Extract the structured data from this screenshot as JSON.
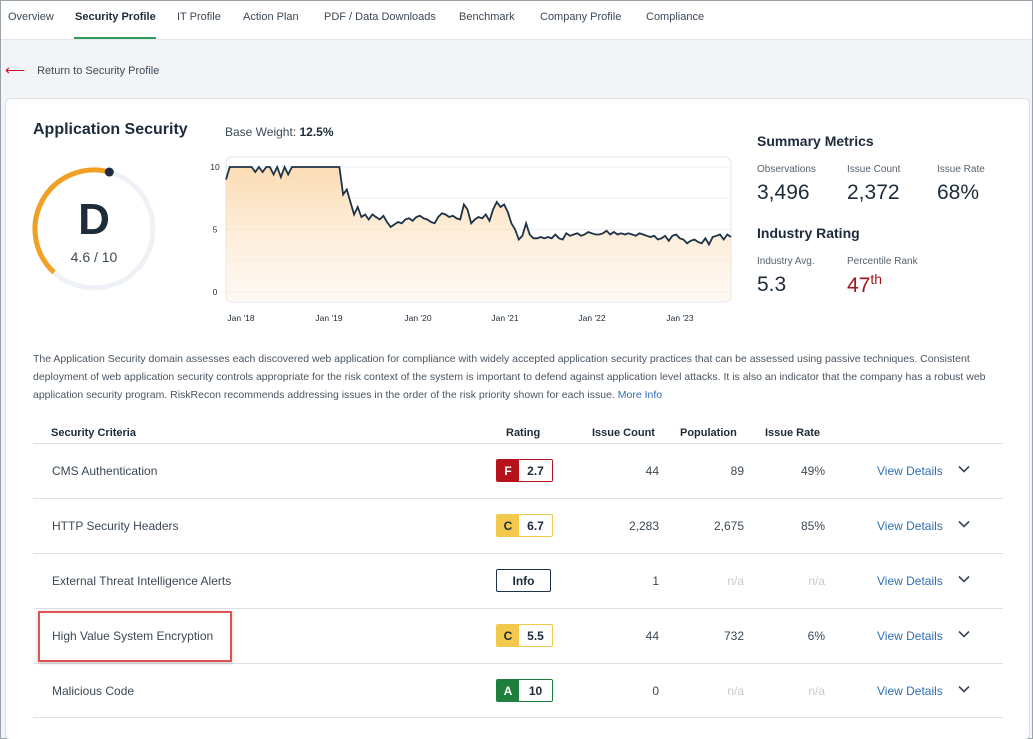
{
  "nav": {
    "tabs": [
      "Overview",
      "Security Profile",
      "IT Profile",
      "Action Plan",
      "PDF / Data Downloads",
      "Benchmark",
      "Company Profile",
      "Compliance"
    ],
    "active_tab": "Security Profile"
  },
  "back_link": "Return to Security Profile",
  "domain": {
    "title": "Application Security",
    "base_weight_label": "Base Weight:",
    "base_weight_value": "12.5%",
    "grade": "D",
    "score": "4.6 / 10",
    "score_value": 4.6
  },
  "chart_data": {
    "type": "area",
    "x_ticks": [
      "Jan '18",
      "Jan '19",
      "Jan '20",
      "Jan '21",
      "Jan '22",
      "Jan '23"
    ],
    "y_ticks": [
      "10",
      "5",
      "0"
    ],
    "ylim": [
      0,
      10
    ],
    "x": [
      0,
      0.5,
      1,
      1.5,
      2,
      2.5,
      3,
      3.5,
      4,
      4.5,
      5,
      5.5,
      6,
      6.5,
      7,
      7.5,
      8,
      8.5,
      9,
      9.5,
      10,
      10.5,
      11,
      11.5,
      12,
      12.5,
      13,
      13.5,
      14,
      14.5,
      15,
      15.5,
      16,
      16.5,
      17,
      17.5,
      18,
      18.5,
      19,
      19.5,
      20,
      20.5,
      21,
      21.5,
      22,
      22.5,
      23,
      23.5,
      24,
      24.5,
      25,
      25.5,
      26,
      26.5,
      27,
      27.5,
      28,
      28.5,
      29,
      29.5,
      30,
      30.5,
      31,
      31.5,
      32,
      32.5,
      33,
      33.5,
      34,
      34.5,
      35,
      35.5,
      36,
      36.5,
      37,
      37.5,
      38,
      38.5,
      39,
      39.5,
      40,
      40.5,
      41,
      41.5,
      42,
      42.5,
      43,
      43.5,
      44,
      44.5,
      45,
      45.5,
      46,
      46.5,
      47,
      47.5,
      48,
      48.5,
      49,
      49.5,
      50,
      50.5,
      51,
      51.5,
      52,
      52.5,
      53,
      53.5,
      54,
      54.5,
      55,
      55.5,
      56,
      56.5,
      57,
      57.5,
      58,
      58.5,
      59,
      59.5,
      60,
      60.5,
      61,
      61.5,
      62,
      62.5,
      63,
      63.5,
      64,
      64.5,
      65,
      65.5,
      66,
      66.5,
      67,
      67.5,
      68,
      68.5,
      69
    ],
    "y": [
      9.0,
      10.0,
      10.0,
      10.0,
      10.0,
      10.0,
      10.0,
      10.0,
      9.6,
      10.0,
      9.6,
      10.0,
      10.0,
      9.4,
      10.0,
      9.2,
      10.0,
      9.4,
      10.0,
      10.0,
      10.0,
      10.0,
      10.0,
      10.0,
      10.0,
      10.0,
      10.0,
      10.0,
      10.0,
      10.0,
      10.0,
      10.0,
      7.8,
      8.2,
      7.2,
      6.2,
      6.8,
      6.0,
      6.2,
      5.8,
      6.2,
      6.0,
      5.8,
      6.1,
      5.6,
      5.2,
      5.4,
      5.6,
      5.5,
      5.8,
      5.9,
      5.7,
      6.0,
      6.1,
      5.9,
      5.8,
      5.6,
      5.5,
      6.0,
      6.3,
      6.2,
      6.0,
      6.1,
      5.9,
      5.8,
      7.0,
      6.6,
      5.5,
      5.8,
      6.0,
      5.9,
      6.2,
      5.7,
      6.6,
      7.2,
      6.8,
      7.0,
      6.4,
      5.5,
      5.0,
      4.2,
      4.5,
      5.5,
      4.6,
      4.3,
      4.3,
      4.4,
      4.3,
      4.4,
      4.3,
      4.6,
      4.3,
      4.2,
      4.7,
      4.5,
      4.6,
      4.7,
      4.5,
      4.6,
      4.8,
      4.7,
      4.6,
      4.6,
      4.7,
      4.9,
      4.6,
      4.8,
      4.6,
      4.7,
      4.6,
      4.7,
      4.6,
      4.5,
      4.7,
      4.6,
      4.5,
      4.4,
      4.5,
      4.2,
      4.3,
      4.5,
      4.1,
      4.5,
      4.6,
      4.3,
      4.2,
      3.9,
      4.1,
      4.2,
      4.0,
      3.9,
      4.3,
      3.8,
      4.4,
      4.5,
      4.6,
      4.2,
      4.6,
      4.4,
      4.4
    ]
  },
  "summary": {
    "title": "Summary Metrics",
    "observations_label": "Observations",
    "observations": "3,496",
    "issue_count_label": "Issue Count",
    "issue_count": "2,372",
    "issue_rate_label": "Issue Rate",
    "issue_rate": "68%"
  },
  "industry": {
    "title": "Industry Rating",
    "avg_label": "Industry Avg.",
    "avg": "5.3",
    "percentile_label": "Percentile Rank",
    "percentile": "47",
    "percentile_suffix": "th"
  },
  "description": "The Application Security domain assesses each discovered web application for compliance with widely accepted application security practices that can be assessed using passive techniques. Consistent deployment of web application security controls appropriate for the risk context of the system is important to defend against application level attacks. It is also an indicator that the company has a robust web application security program. RiskRecon recommends addressing issues in the order of the risk priority shown for each issue.",
  "more_info": "More Info",
  "table": {
    "headers": {
      "criteria": "Security Criteria",
      "rating": "Rating",
      "issue_count": "Issue Count",
      "population": "Population",
      "issue_rate": "Issue Rate"
    },
    "rows": [
      {
        "name": "CMS Authentication",
        "grade": "F",
        "score": "2.7",
        "grade_color": "#b5121b",
        "issue_count": "44",
        "population": "89",
        "issue_rate": "49%",
        "details": "View Details"
      },
      {
        "name": "HTTP Security Headers",
        "grade": "C",
        "score": "6.7",
        "grade_color": "#f2c94c",
        "issue_count": "2,283",
        "population": "2,675",
        "issue_rate": "85%",
        "details": "View Details"
      },
      {
        "name": "External Threat Intelligence Alerts",
        "info": "Info",
        "issue_count": "1",
        "population": "n/a",
        "issue_rate": "n/a",
        "details": "View Details"
      },
      {
        "name": "High Value System Encryption",
        "grade": "C",
        "score": "5.5",
        "grade_color": "#f2c94c",
        "issue_count": "44",
        "population": "732",
        "issue_rate": "6%",
        "details": "View Details"
      },
      {
        "name": "Malicious Code",
        "grade": "A",
        "score": "10",
        "grade_color": "#1e7e3c",
        "issue_count": "0",
        "population": "n/a",
        "issue_rate": "n/a",
        "details": "View Details"
      }
    ]
  },
  "colors": {
    "gauge": "#f0a022",
    "gauge_track": "#eef1f5",
    "line": "#1d3247",
    "area": "#fbd9ad",
    "percentile": "#a4141e"
  }
}
